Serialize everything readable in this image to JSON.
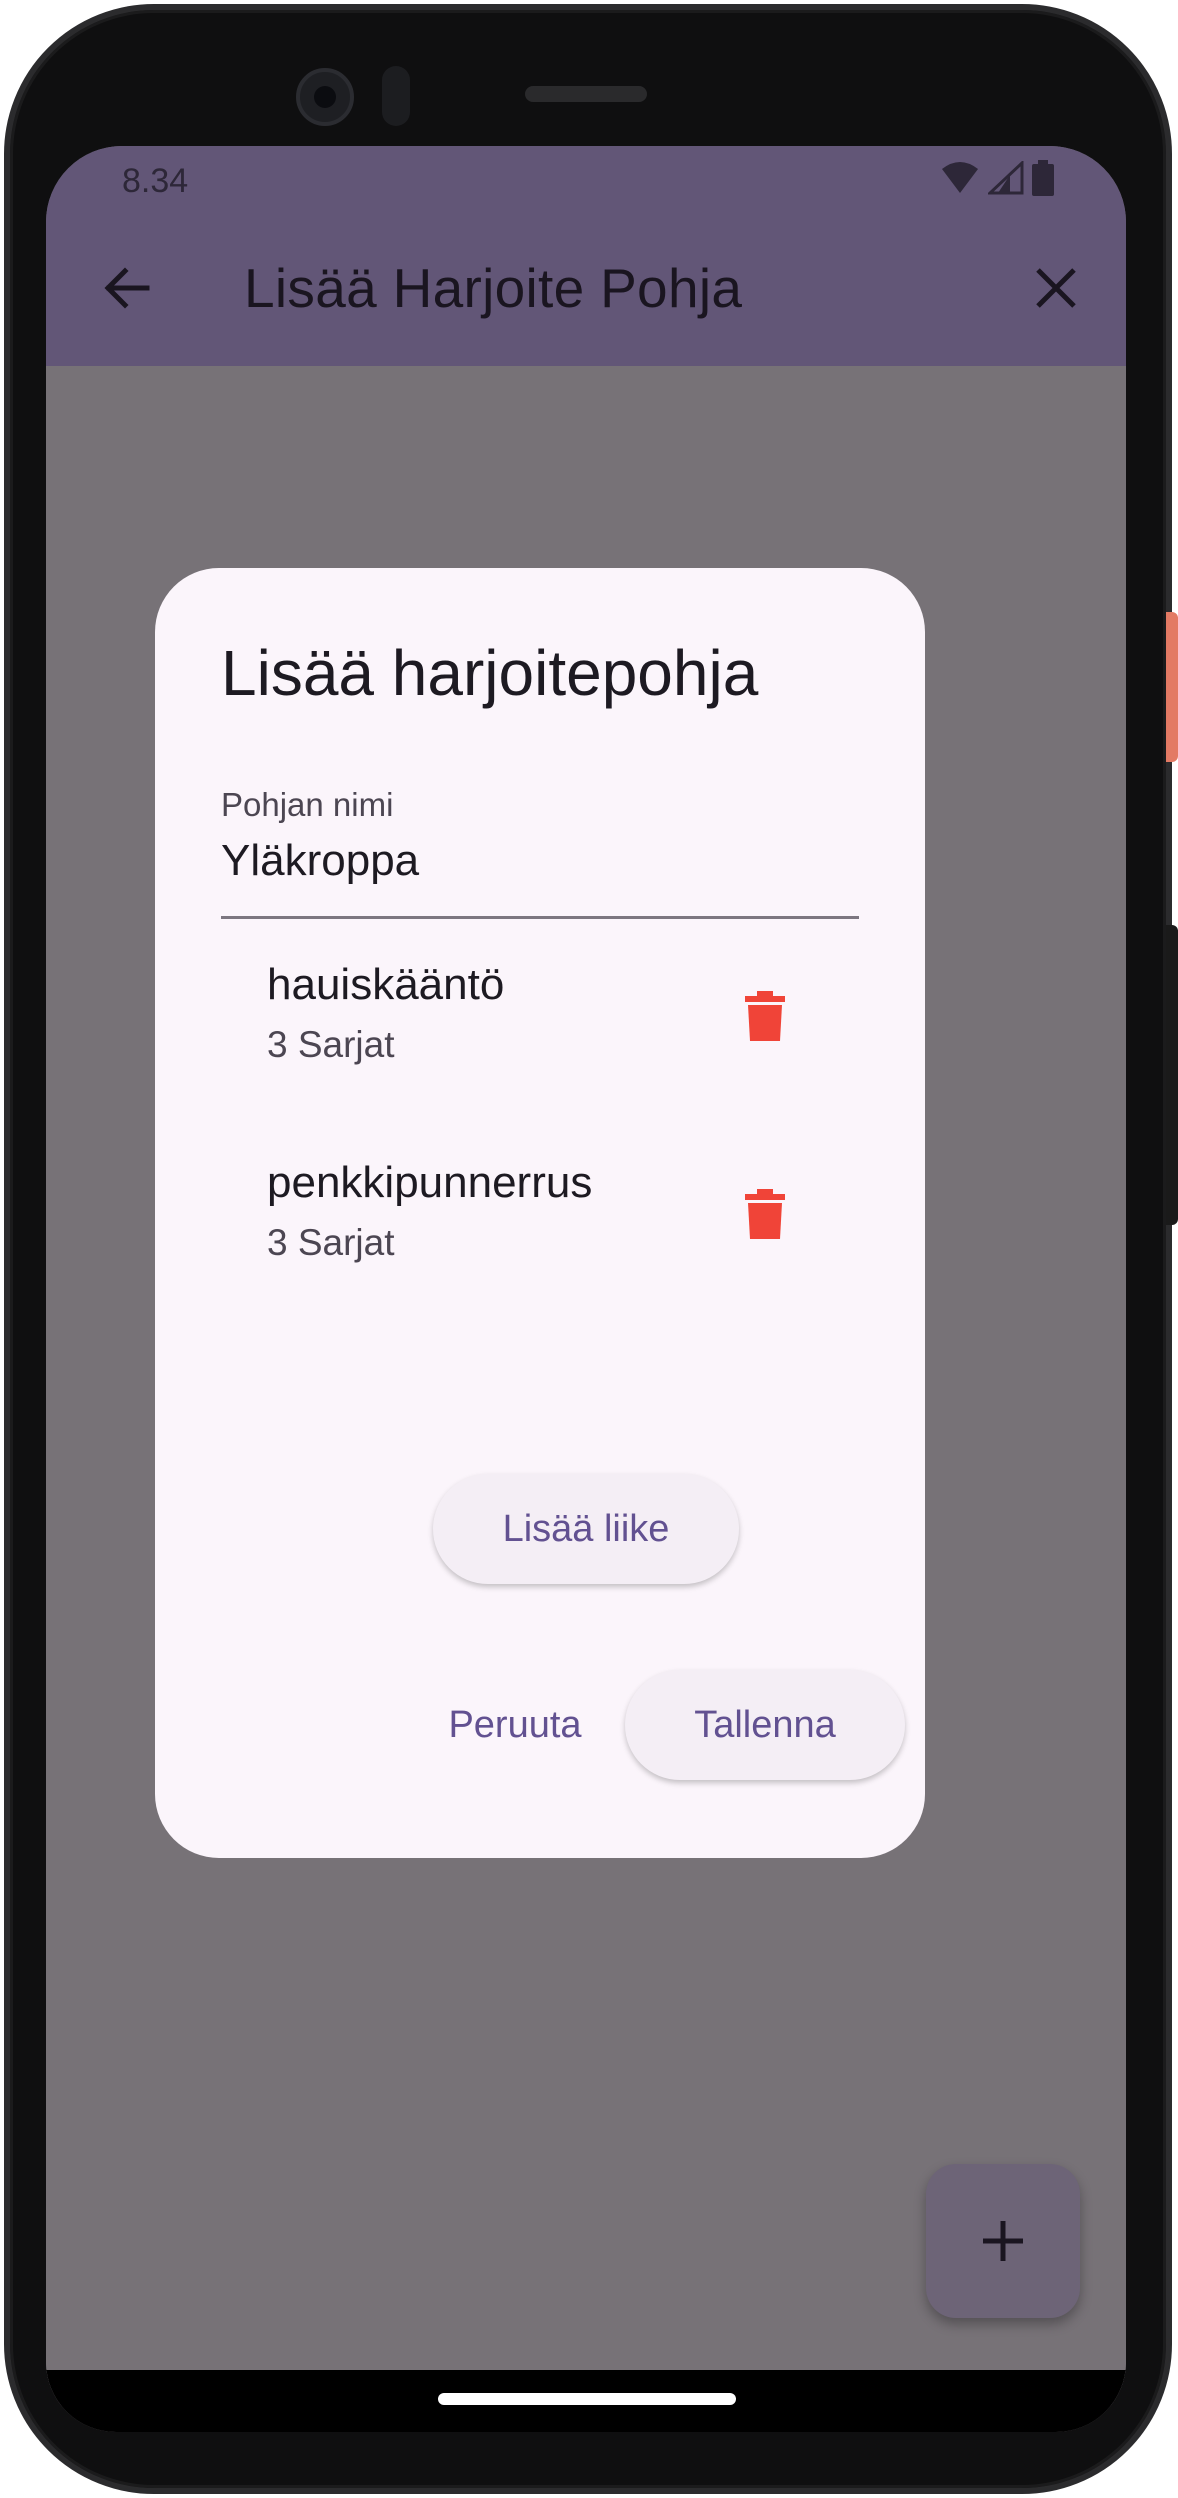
{
  "status_bar": {
    "time": "8.34",
    "icons": [
      "wifi-icon",
      "cell-signal-icon",
      "battery-icon"
    ]
  },
  "app_bar": {
    "title": "Lisää Harjoite Pohja",
    "back_icon": "arrow-back-icon",
    "close_icon": "close-icon"
  },
  "dialog": {
    "title": "Lisää harjoitepohja",
    "name_field": {
      "label": "Pohjan nimi",
      "value": "Yläkroppa"
    },
    "exercises": [
      {
        "name": "hauiskääntö",
        "sets": "3 Sarjat"
      },
      {
        "name": "penkkipunnerrus",
        "sets": "3 Sarjat"
      }
    ],
    "add_move_label": "Lisää liike",
    "cancel_label": "Peruuta",
    "save_label": "Tallenna"
  },
  "fab": {
    "icon": "plus-icon"
  },
  "colors": {
    "app_bar": "#625677",
    "scrim_background": "#777277",
    "dialog_surface": "#fbf5fb",
    "accent": "#625191",
    "delete": "#f04438"
  }
}
